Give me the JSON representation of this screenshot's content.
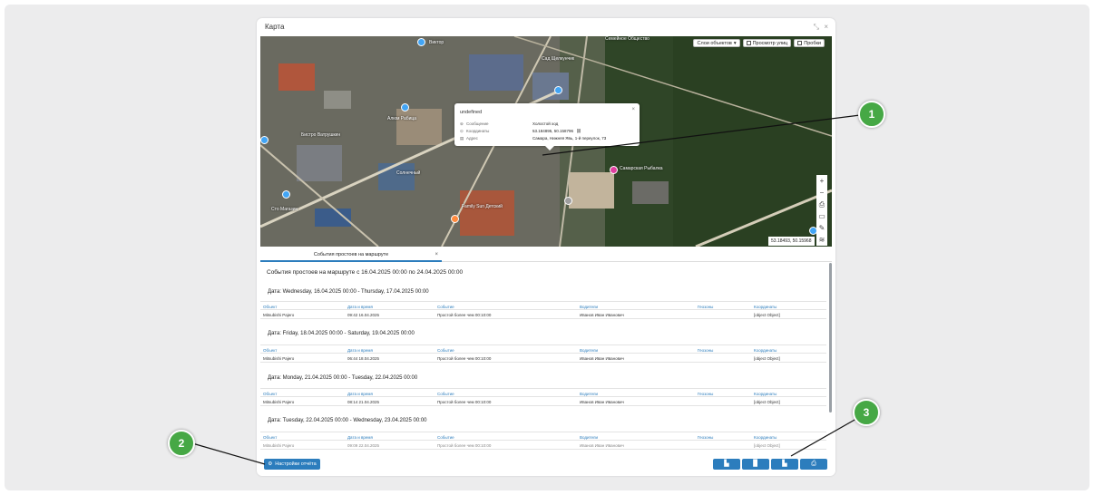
{
  "panel": {
    "title": "Карта",
    "icons": [
      "collapse-icon",
      "close-icon"
    ]
  },
  "map": {
    "layers_label": "Слои объектов",
    "street_view_label": "Просмотр улиц",
    "traffic_label": "Пробки",
    "coords": "53.18493, 50.15968",
    "places": [
      "Виктор",
      "Алюм Рабица",
      "Сад Щелкунчик",
      "Бистро Ватрушкин",
      "Солнечный",
      "Family Sun Детский",
      "Семейное Общество",
      "Самарская Рыбалка",
      "Сто Магазин"
    ],
    "tools": [
      "+",
      "−",
      "⎙",
      "▭",
      "✎",
      "≋"
    ]
  },
  "popup": {
    "title": "undefined",
    "rows": [
      {
        "label": "Сообщение",
        "value": "Холостой ход"
      },
      {
        "label": "Координаты",
        "value": "53.184895, 50.158796"
      },
      {
        "label": "Адрес",
        "value": "Самара, Нижняя Явь, 1-й переулок, 73"
      }
    ]
  },
  "tab": {
    "label": "События простоев на маршруте"
  },
  "report": {
    "title": "События простоев на маршруте с 16.04.2025 00:00 по 24.04.2025 00:00",
    "columns": [
      "Объект",
      "Дата и время",
      "Событие",
      "Водители",
      "Геозоны",
      "Координаты"
    ],
    "sections": [
      {
        "header": "Дата: Wednesday, 16.04.2025 00:00 - Thursday, 17.04.2025 00:00",
        "row": [
          "Mitsubishi Pajero",
          "09:42 16.04.2025",
          "Простой более чем 00:10:00",
          "Иванов Иван Иванович",
          "",
          "[object Object]"
        ]
      },
      {
        "header": "Дата: Friday, 18.04.2025 00:00 - Saturday, 19.04.2025 00:00",
        "row": [
          "Mitsubishi Pajero",
          "06:44 18.04.2025",
          "Простой более чем 00:10:00",
          "Иванов Иван Иванович",
          "",
          "[object Object]"
        ]
      },
      {
        "header": "Дата: Monday, 21.04.2025 00:00 - Tuesday, 22.04.2025 00:00",
        "row": [
          "Mitsubishi Pajero",
          "08:14 21.04.2025",
          "Простой более чем 00:10:00",
          "Иванов Иван Иванович",
          "",
          "[object Object]"
        ]
      },
      {
        "header": "Дата: Tuesday, 22.04.2025 00:00 - Wednesday, 23.04.2025 00:00",
        "row": [
          "Mitsubishi Pajero",
          "09:09 22.04.2025",
          "Простой более чем 00:10:00",
          "Иванов Иван Иванович",
          "",
          "[object Object]"
        ]
      }
    ]
  },
  "settings_button": "Настройки отчёта",
  "export_buttons": [
    "xls-export-icon",
    "pdf-export-icon",
    "doc-export-icon",
    "print-icon"
  ],
  "callouts": [
    "1",
    "2",
    "3"
  ],
  "colors": {
    "accent": "#2c7dbd",
    "callout": "#46a845"
  }
}
